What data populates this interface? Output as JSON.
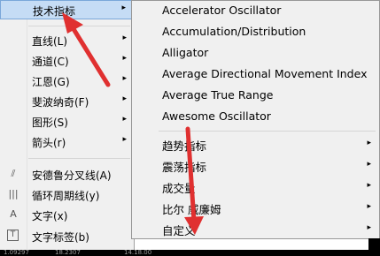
{
  "left_menu": {
    "items": [
      {
        "label": "技术指标",
        "arrow": "▸"
      },
      {
        "label": "直线(L)",
        "arrow": "▸"
      },
      {
        "label": "通道(C)",
        "arrow": "▸"
      },
      {
        "label": "江恩(G)",
        "arrow": "▸"
      },
      {
        "label": "斐波纳奇(F)",
        "arrow": "▸"
      },
      {
        "label": "图形(S)",
        "arrow": "▸"
      },
      {
        "label": "箭头(r)",
        "arrow": "▸"
      },
      {
        "label": "安德鲁分叉线(A)",
        "icon": "⫽"
      },
      {
        "label": "循环周期线(y)",
        "icon": "|||"
      },
      {
        "label": "文字(x)",
        "icon": "A"
      },
      {
        "label": "文字标签(b)",
        "icon": "T"
      }
    ]
  },
  "right_menu": {
    "items": [
      {
        "label": "Accelerator Oscillator"
      },
      {
        "label": "Accumulation/Distribution"
      },
      {
        "label": "Alligator"
      },
      {
        "label": "Average Directional Movement Index"
      },
      {
        "label": "Average True Range"
      },
      {
        "label": "Awesome Oscillator"
      },
      {
        "label": "趋势指标",
        "arrow": "▸"
      },
      {
        "label": "震荡指标",
        "arrow": "▸"
      },
      {
        "label": "成交量",
        "arrow": "▸"
      },
      {
        "label": "比尔 威廉姆",
        "arrow": "▸"
      },
      {
        "label": "自定义",
        "arrow": "▸"
      }
    ]
  },
  "chart_strip": {
    "text_a": "1.09297",
    "text_b": "18.2307",
    "text_c": "14.18.00"
  },
  "colors": {
    "annotation": "#e03030",
    "highlight": "#c5dcf5"
  }
}
